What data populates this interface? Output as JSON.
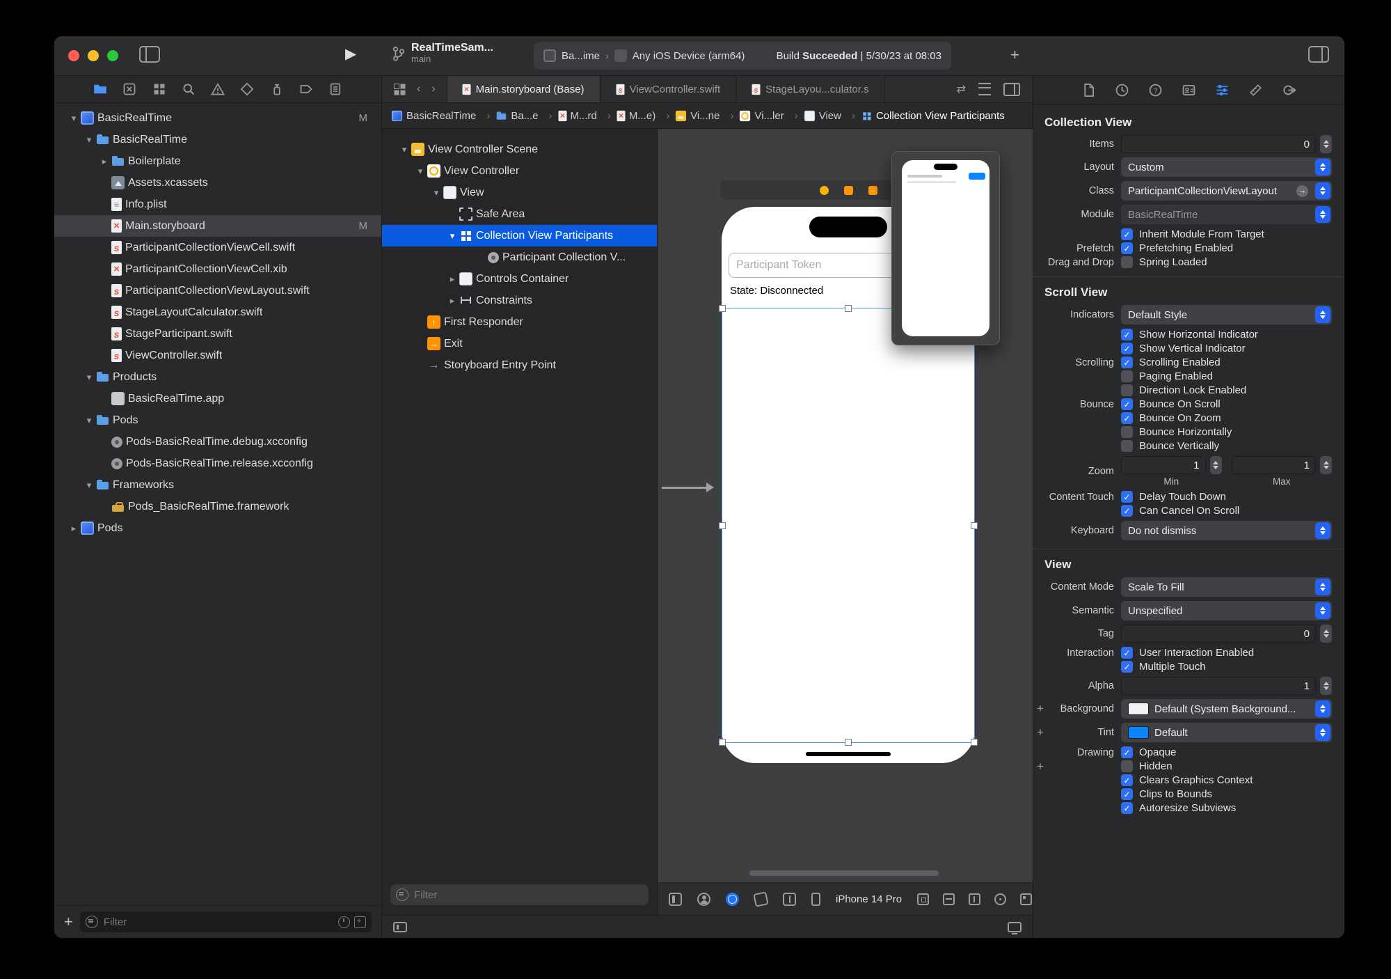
{
  "colors": {
    "accent_blue": "#2f6ff0",
    "selection_blue": "#0a5be0",
    "swift_orange": "#f05138",
    "folder_blue": "#5ba0e6",
    "background_swatch": "#f2f2f5",
    "tint_swatch": "#0a84ff"
  },
  "toolbar": {
    "project_name": "RealTimeSam...",
    "branch_name": "main",
    "scheme": "Ba...ime",
    "destination": "Any iOS Device (arm64)",
    "build_prefix": "Build",
    "build_status": "Succeeded",
    "build_time": "| 5/30/23 at 08:03"
  },
  "navigator": {
    "filter_placeholder": "Filter",
    "items": [
      {
        "label": "BasicRealTime",
        "icon": "project",
        "depth": 0,
        "chevron": "down",
        "badge": "M"
      },
      {
        "label": "BasicRealTime",
        "icon": "folder",
        "depth": 1,
        "chevron": "down"
      },
      {
        "label": "Boilerplate",
        "icon": "folder",
        "depth": 2,
        "chevron": "right"
      },
      {
        "label": "Assets.xcassets",
        "icon": "assets",
        "depth": 2
      },
      {
        "label": "Info.plist",
        "icon": "plist",
        "depth": 2
      },
      {
        "label": "Main.storyboard",
        "icon": "storyboard",
        "depth": 2,
        "badge": "M",
        "selected": true
      },
      {
        "label": "ParticipantCollectionViewCell.swift",
        "icon": "swift",
        "depth": 2
      },
      {
        "label": "ParticipantCollectionViewCell.xib",
        "icon": "xib",
        "depth": 2
      },
      {
        "label": "ParticipantCollectionViewLayout.swift",
        "icon": "swift",
        "depth": 2
      },
      {
        "label": "StageLayoutCalculator.swift",
        "icon": "swift",
        "depth": 2
      },
      {
        "label": "StageParticipant.swift",
        "icon": "swift",
        "depth": 2
      },
      {
        "label": "ViewController.swift",
        "icon": "swift",
        "depth": 2
      },
      {
        "label": "Products",
        "icon": "folder",
        "depth": 1,
        "chevron": "down"
      },
      {
        "label": "BasicRealTime.app",
        "icon": "app",
        "depth": 2
      },
      {
        "label": "Pods",
        "icon": "folder",
        "depth": 1,
        "chevron": "down"
      },
      {
        "label": "Pods-BasicRealTime.debug.xcconfig",
        "icon": "xcconfig",
        "depth": 2
      },
      {
        "label": "Pods-BasicRealTime.release.xcconfig",
        "icon": "xcconfig",
        "depth": 2
      },
      {
        "label": "Frameworks",
        "icon": "folder",
        "depth": 1,
        "chevron": "down"
      },
      {
        "label": "Pods_BasicRealTime.framework",
        "icon": "framework",
        "depth": 2
      },
      {
        "label": "Pods",
        "icon": "project",
        "depth": 0,
        "chevron": "right"
      }
    ]
  },
  "editor": {
    "tabs": [
      {
        "label": "Main.storyboard (Base)",
        "icon": "storyboard",
        "active": true
      },
      {
        "label": "ViewController.swift",
        "icon": "swift"
      },
      {
        "label": "StageLayou...culator.s",
        "icon": "swift",
        "italic": true
      }
    ],
    "breadcrumb": [
      {
        "label": "BasicRealTime",
        "icon": "project"
      },
      {
        "label": "Ba...e",
        "icon": "folder"
      },
      {
        "label": "M...rd",
        "icon": "storyboard"
      },
      {
        "label": "M...e)",
        "icon": "storyboard"
      },
      {
        "label": "Vi...ne",
        "icon": "scene"
      },
      {
        "label": "Vi...ler",
        "icon": "vc"
      },
      {
        "label": "View",
        "icon": "view"
      },
      {
        "label": "Collection View Participants",
        "icon": "collection",
        "current": true
      }
    ]
  },
  "outline": {
    "filter_placeholder": "Filter",
    "items": [
      {
        "label": "View Controller Scene",
        "icon": "scene",
        "depth": 0,
        "chevron": "down"
      },
      {
        "label": "View Controller",
        "icon": "vc",
        "depth": 1,
        "chevron": "down"
      },
      {
        "label": "View",
        "icon": "view",
        "depth": 2,
        "chevron": "down"
      },
      {
        "label": "Safe Area",
        "icon": "safearea",
        "depth": 3
      },
      {
        "label": "Collection View Participants",
        "icon": "collection",
        "depth": 3,
        "chevron": "down",
        "selected": true
      },
      {
        "label": "Participant Collection V...",
        "icon": "cell",
        "depth": 4
      },
      {
        "label": "Controls Container",
        "icon": "view",
        "depth": 3,
        "chevron": "right"
      },
      {
        "label": "Constraints",
        "icon": "constraints",
        "depth": 3,
        "chevron": "right"
      },
      {
        "label": "First Responder",
        "icon": "responder",
        "depth": 1
      },
      {
        "label": "Exit",
        "icon": "exit",
        "depth": 1
      },
      {
        "label": "Storyboard Entry Point",
        "icon": "entry",
        "depth": 1
      }
    ]
  },
  "canvas": {
    "textfield_placeholder": "Participant Token",
    "state_label": "State: Disconnected",
    "device_name": "iPhone 14 Pro"
  },
  "inspector": {
    "cv": {
      "title": "Collection View",
      "items_label": "Items",
      "items_value": "0",
      "layout_label": "Layout",
      "layout_value": "Custom",
      "class_label": "Class",
      "class_value": "ParticipantCollectionViewLayout",
      "module_label": "Module",
      "module_value": "BasicRealTime",
      "inherit_cb": "Inherit Module From Target",
      "inherit_checked": true,
      "prefetch_label": "Prefetch",
      "prefetch_cb": "Prefetching Enabled",
      "prefetch_checked": true,
      "dragdrop_label": "Drag and Drop",
      "dragdrop_cb": "Spring Loaded",
      "dragdrop_checked": false
    },
    "sv": {
      "title": "Scroll View",
      "indicators_label": "Indicators",
      "indicators_value": "Default Style",
      "show_h_cb": "Show Horizontal Indicator",
      "show_h_checked": true,
      "show_v_cb": "Show Vertical Indicator",
      "show_v_checked": true,
      "scrolling_label": "Scrolling",
      "scrolling_cb": "Scrolling Enabled",
      "scrolling_checked": true,
      "paging_cb": "Paging Enabled",
      "paging_checked": false,
      "dirlock_cb": "Direction Lock Enabled",
      "dirlock_checked": false,
      "bounce_label": "Bounce",
      "bounce_scroll_cb": "Bounce On Scroll",
      "bounce_scroll_checked": true,
      "bounce_zoom_cb": "Bounce On Zoom",
      "bounce_zoom_checked": true,
      "bounce_h_cb": "Bounce Horizontally",
      "bounce_h_checked": false,
      "bounce_v_cb": "Bounce Vertically",
      "bounce_v_checked": false,
      "zoom_label": "Zoom",
      "zoom_min_value": "1",
      "zoom_max_value": "1",
      "zoom_min_label": "Min",
      "zoom_max_label": "Max",
      "content_touch_label": "Content Touch",
      "delay_cb": "Delay Touch Down",
      "delay_checked": true,
      "cancel_cb": "Can Cancel On Scroll",
      "cancel_checked": true,
      "keyboard_label": "Keyboard",
      "keyboard_value": "Do not dismiss"
    },
    "vw": {
      "title": "View",
      "content_mode_label": "Content Mode",
      "content_mode_value": "Scale To Fill",
      "semantic_label": "Semantic",
      "semantic_value": "Unspecified",
      "tag_label": "Tag",
      "tag_value": "0",
      "interaction_label": "Interaction",
      "interaction_cb": "User Interaction Enabled",
      "interaction_checked": true,
      "multitouch_cb": "Multiple Touch",
      "multitouch_checked": true,
      "alpha_label": "Alpha",
      "alpha_value": "1",
      "background_label": "Background",
      "background_value": "Default (System Background...",
      "background_swatch": "#f2f2f5",
      "tint_label": "Tint",
      "tint_value": "Default",
      "tint_swatch": "#0a84ff",
      "drawing_label": "Drawing",
      "opaque_cb": "Opaque",
      "opaque_checked": true,
      "hidden_cb": "Hidden",
      "hidden_checked": false,
      "clears_cb": "Clears Graphics Context",
      "clears_checked": true,
      "clips_cb": "Clips to Bounds",
      "clips_checked": true,
      "autoresize_cb": "Autoresize Subviews",
      "autoresize_checked": true
    }
  }
}
